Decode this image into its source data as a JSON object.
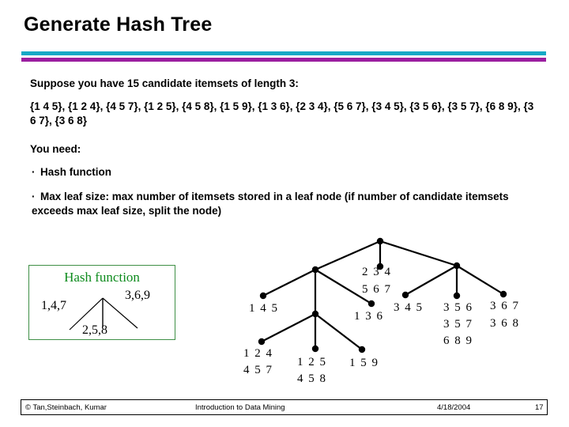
{
  "slide": {
    "title": "Generate Hash Tree",
    "accent_cyan": "#16a9c6",
    "accent_purple": "#9b1fa0"
  },
  "body": {
    "suppose_line": "Suppose you have 15 candidate itemsets of length 3:",
    "itemsets_line": "{1 4 5}, {1 2 4}, {4 5 7}, {1 2 5}, {4 5 8}, {1 5 9}, {1 3 6}, {2 3 4}, {5 6 7}, {3 4 5}, {3 5 6}, {3 5 7}, {6 8 9}, {3 6 7}, {3 6 8}",
    "you_need_label": "You need:",
    "bullet_char": "·",
    "bullet_hash": "Hash function",
    "bullet_maxleaf": "Max leaf size: max number of itemsets stored in a leaf node (if number of candidate itemsets exceeds max leaf size, split the node)",
    "itemsets": [
      "{1 4 5}",
      "{1 2 4}",
      "{4 5 7}",
      "{1 2 5}",
      "{4 5 8}",
      "{1 5 9}",
      "{1 3 6}",
      "{2 3 4}",
      "{5 6 7}",
      "{3 4 5}",
      "{3 5 6}",
      "{3 5 7}",
      "{6 8 9}",
      "{3 6 7}",
      "{3 6 8}"
    ],
    "itemset_count": 15,
    "itemset_length": 3
  },
  "hash_function": {
    "title": "Hash function",
    "title_color": "#0d8b1d",
    "border_color": "#3f8f46",
    "branch_left": "1,4,7",
    "branch_middle": "2,5,8",
    "branch_right": "3,6,9"
  },
  "tree": {
    "leaves": {
      "l_145": "1 4 5",
      "l_124": "1 2 4",
      "l_457": "4 5 7",
      "l_125": "1 2 5",
      "l_458": "4 5 8",
      "l_159": "1 5 9",
      "l_136": "1 3 6",
      "l_234": "2 3 4",
      "l_567": "5 6 7",
      "l_345": "3 4 5",
      "l_356": "3 5 6",
      "l_357": "3 5 7",
      "l_689": "6 8 9",
      "l_367": "3 6 7",
      "l_368": "3 6 8"
    }
  },
  "footer": {
    "credit": "© Tan,Steinbach, Kumar",
    "course": "Introduction to Data Mining",
    "date": "4/18/2004",
    "page": "17"
  }
}
